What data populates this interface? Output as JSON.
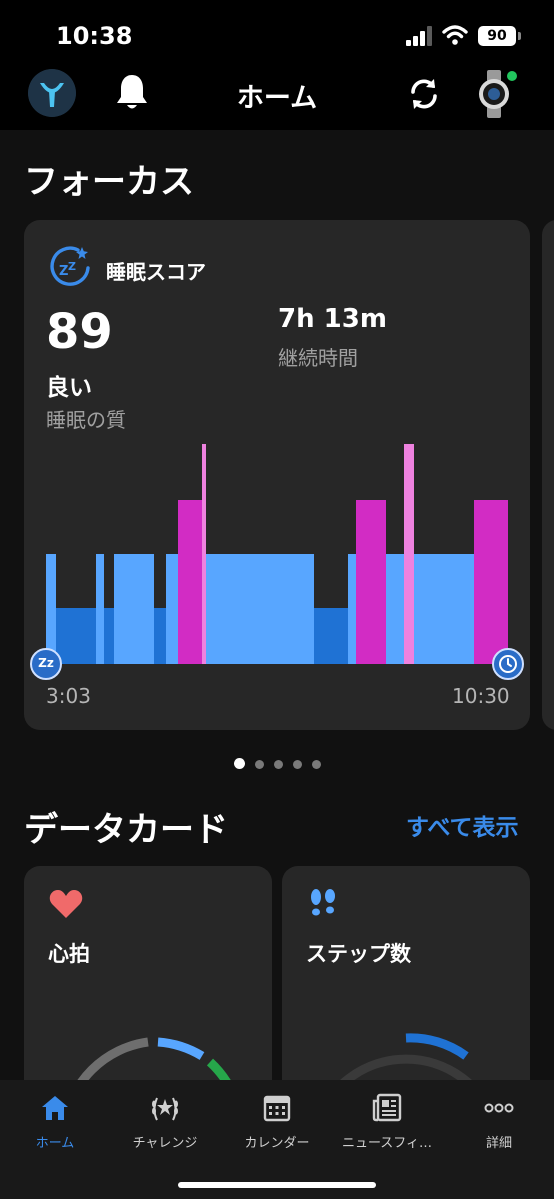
{
  "status_bar": {
    "time": "10:38",
    "battery": "90"
  },
  "header": {
    "title": "ホーム",
    "icons": [
      "app-logo",
      "bell-icon",
      "sync-icon",
      "watch-device-icon"
    ]
  },
  "focus": {
    "section_title": "フォーカス",
    "card": {
      "label": "睡眠スコア",
      "score": "89",
      "quality": "良い",
      "quality_label": "睡眠の質",
      "duration": "7h 13m",
      "duration_label": "継続時間",
      "start_time": "3:03",
      "end_time": "10:30",
      "start_marker": "Zz",
      "end_marker_icon": "clock-icon"
    },
    "pager": {
      "count": 5,
      "active": 0
    }
  },
  "data_cards": {
    "section_title": "データカード",
    "see_all": "すべて表示",
    "cards": [
      {
        "label": "心拍",
        "icon": "heart-icon"
      },
      {
        "label": "ステップ数",
        "icon": "footsteps-icon"
      }
    ]
  },
  "nav": {
    "items": [
      {
        "label": "ホーム",
        "icon": "home-icon",
        "active": true
      },
      {
        "label": "チャレンジ",
        "icon": "laurel-icon",
        "active": false
      },
      {
        "label": "カレンダー",
        "icon": "calendar-icon",
        "active": false
      },
      {
        "label": "ニュースフィ…",
        "icon": "newsfeed-icon",
        "active": false
      },
      {
        "label": "詳細",
        "icon": "more-icon",
        "active": false
      }
    ]
  },
  "colors": {
    "deep_sleep": "#1f72d4",
    "light_sleep": "#58a6ff",
    "rem_sleep": "#d22cc4",
    "awake": "#ee82df",
    "accent": "#3a8bea"
  }
}
